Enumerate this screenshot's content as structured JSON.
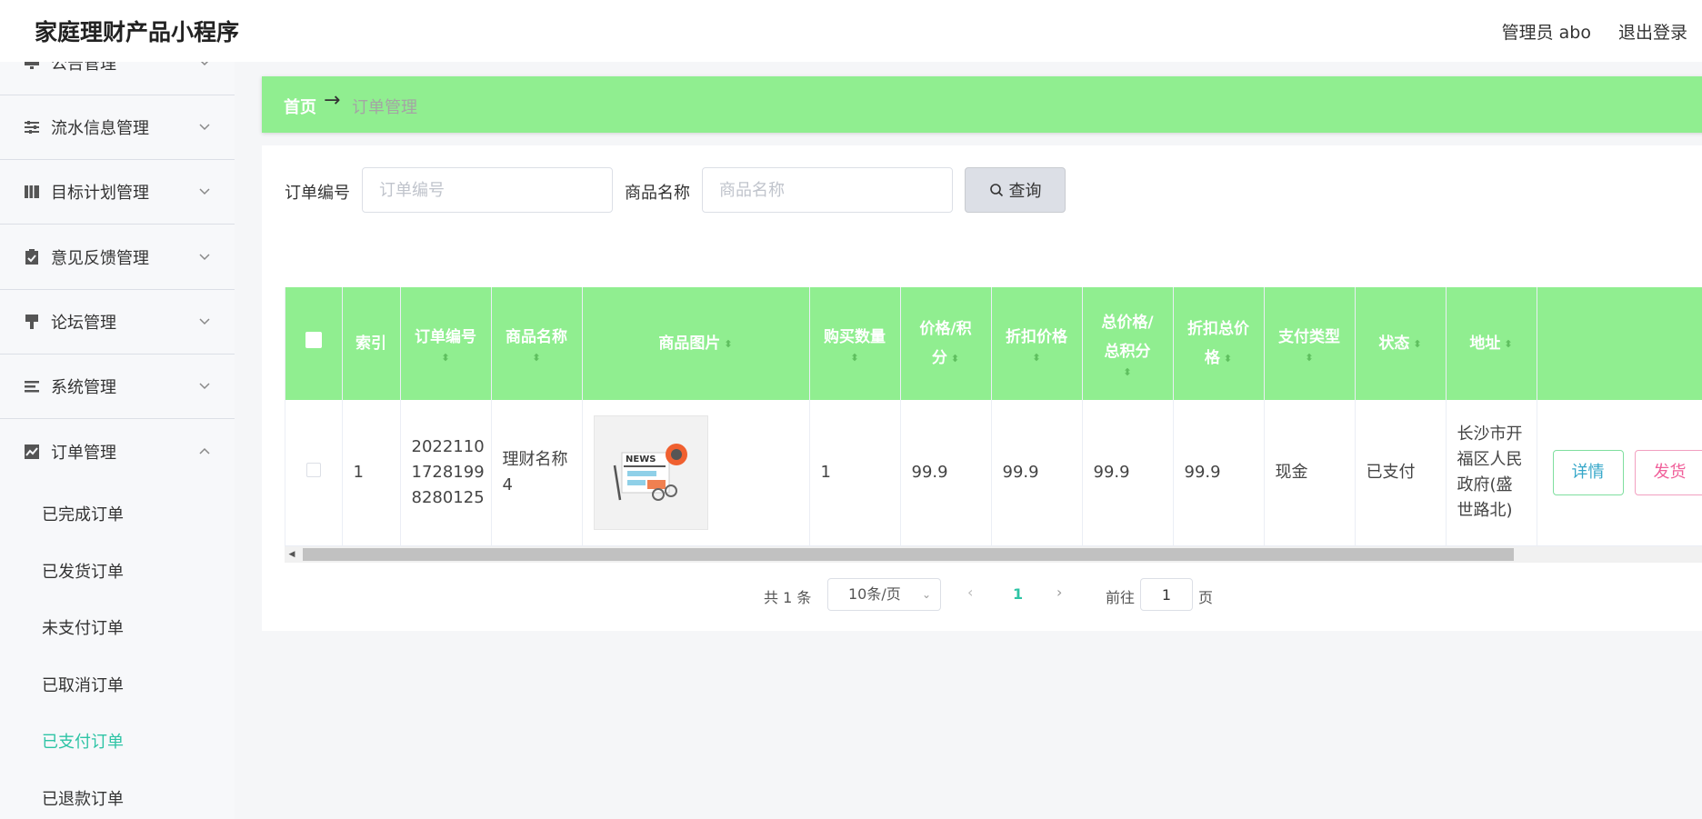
{
  "header": {
    "app_title": "家庭理财产品小程序",
    "user": "管理员 abo",
    "logout": "退出登录"
  },
  "sidebar": {
    "items": [
      {
        "label": "公告管理",
        "icon": "monitor-icon"
      },
      {
        "label": "流水信息管理",
        "icon": "sliders-icon"
      },
      {
        "label": "目标计划管理",
        "icon": "book-icon"
      },
      {
        "label": "意见反馈管理",
        "icon": "clipboard-check-icon"
      },
      {
        "label": "论坛管理",
        "icon": "brush-icon"
      },
      {
        "label": "系统管理",
        "icon": "list-icon"
      },
      {
        "label": "订单管理",
        "icon": "chart-icon"
      }
    ],
    "order_submenu": [
      {
        "label": "已完成订单"
      },
      {
        "label": "已发货订单"
      },
      {
        "label": "未支付订单"
      },
      {
        "label": "已取消订单"
      },
      {
        "label": "已支付订单",
        "active": true
      },
      {
        "label": "已退款订单"
      }
    ]
  },
  "breadcrumb": {
    "home": "首页",
    "arrow": "→",
    "current": "订单管理"
  },
  "search": {
    "order_no_label": "订单编号",
    "order_no_placeholder": "订单编号",
    "product_name_label": "商品名称",
    "product_name_placeholder": "商品名称",
    "button": "查询"
  },
  "table": {
    "columns": {
      "index": "索引",
      "order_no": "订单编号",
      "product_name": "商品名称",
      "product_image": "商品图片",
      "quantity": "购买数量",
      "price_line1": "价格/积",
      "price_line2": "分",
      "discount_price": "折扣价格",
      "total_line1": "总价格/",
      "total_line2": "总积分",
      "discount_total_line1": "折扣总价",
      "discount_total_line2": "格",
      "pay_type": "支付类型",
      "status": "状态",
      "address": "地址"
    },
    "rows": [
      {
        "index": "1",
        "order_no": "20221101728199 8280125",
        "order_no_lines": [
          "2022110",
          "1728199",
          "8280125"
        ],
        "product_name_lines": [
          "理财名称",
          "4"
        ],
        "quantity": "1",
        "price": "99.9",
        "discount_price": "99.9",
        "total": "99.9",
        "discount_total": "99.9",
        "pay_type": "现金",
        "status": "已支付",
        "address_lines": [
          "长沙市开",
          "福区人民",
          "政府(盛",
          "世路北)"
        ],
        "detail_button": "详情",
        "ship_button": "发货"
      }
    ]
  },
  "pagination": {
    "total": "共 1 条",
    "page_size": "10条/页",
    "current_page": "1",
    "goto_label": "前往",
    "goto_value": "1",
    "page_suffix": "页"
  },
  "colors": {
    "header_green": "#90ee90",
    "accent_teal": "#2ec4a5"
  }
}
